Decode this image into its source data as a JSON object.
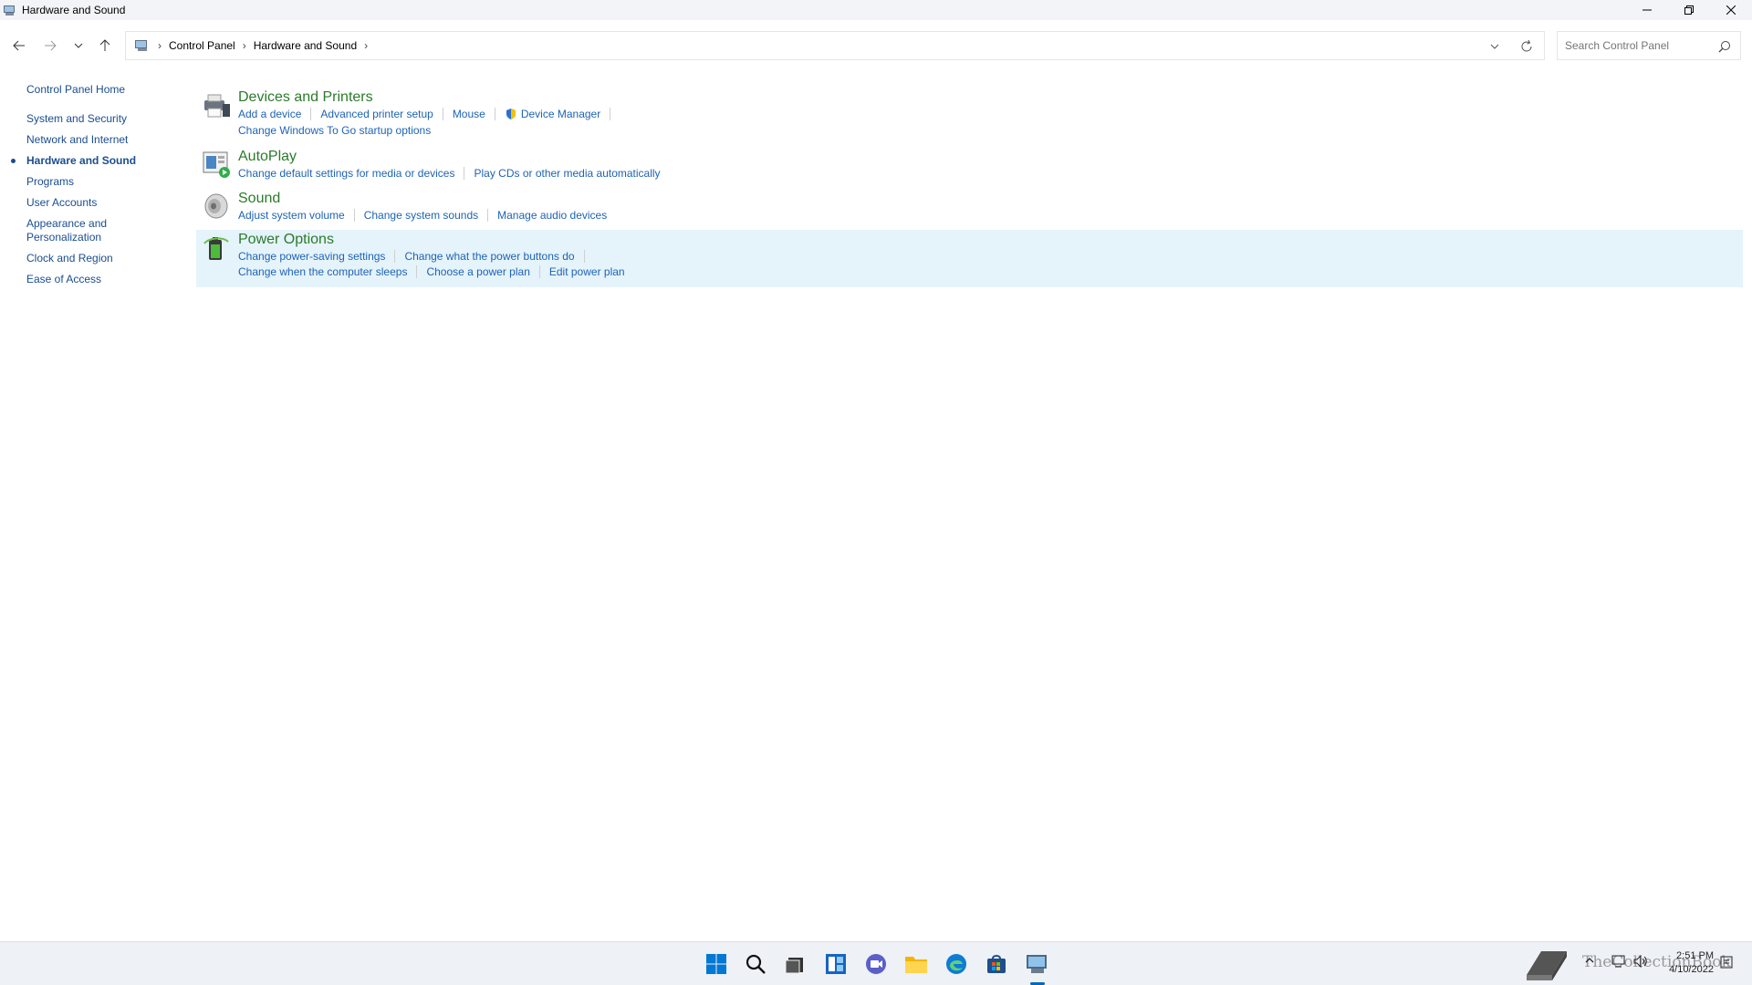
{
  "window": {
    "title": "Hardware and Sound",
    "controls": {
      "minimize": "minimize-icon",
      "maximize": "restore-icon",
      "close": "close-icon"
    }
  },
  "address_bar": {
    "breadcrumbs": [
      "Control Panel",
      "Hardware and Sound"
    ],
    "search_placeholder": "Search Control Panel"
  },
  "left_nav": {
    "home": "Control Panel Home",
    "items": [
      {
        "label": "System and Security",
        "active": false
      },
      {
        "label": "Network and Internet",
        "active": false
      },
      {
        "label": "Hardware and Sound",
        "active": true
      },
      {
        "label": "Programs",
        "active": false
      },
      {
        "label": "User Accounts",
        "active": false
      },
      {
        "label": "Appearance and Personalization",
        "active": false
      },
      {
        "label": "Clock and Region",
        "active": false
      },
      {
        "label": "Ease of Access",
        "active": false
      }
    ]
  },
  "categories": {
    "devices": {
      "title": "Devices and Printers",
      "links": [
        "Add a device",
        "Advanced printer setup",
        "Mouse",
        "Device Manager",
        "Change Windows To Go startup options"
      ]
    },
    "autoplay": {
      "title": "AutoPlay",
      "links": [
        "Change default settings for media or devices",
        "Play CDs or other media automatically"
      ]
    },
    "sound": {
      "title": "Sound",
      "links": [
        "Adjust system volume",
        "Change system sounds",
        "Manage audio devices"
      ]
    },
    "power": {
      "title": "Power Options",
      "links": [
        "Change power-saving settings",
        "Change what the power buttons do",
        "Change when the computer sleeps",
        "Choose a power plan",
        "Edit power plan"
      ]
    }
  },
  "taskbar": {
    "icons": [
      "windows-start-icon",
      "search-icon",
      "task-view-icon",
      "widgets-icon",
      "chat-icon",
      "file-explorer-icon",
      "edge-icon",
      "store-icon",
      "control-panel-icon"
    ],
    "watermark": "TheCollectionBook",
    "time": "2:51 PM",
    "date": "4/10/2022",
    "accent": "#0067c0"
  }
}
